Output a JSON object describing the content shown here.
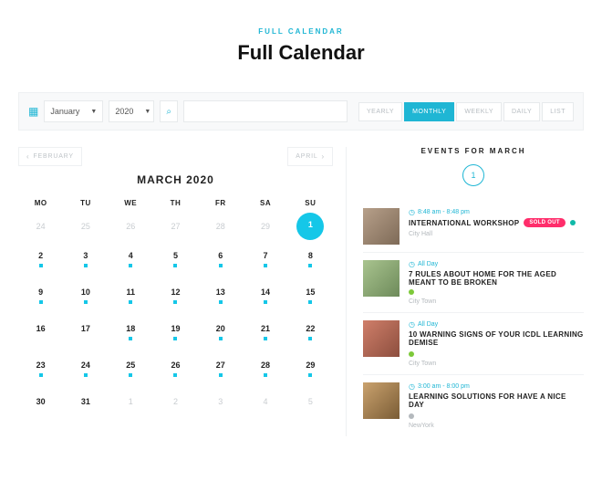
{
  "header": {
    "eyebrow": "FULL CALENDAR",
    "title": "Full Calendar"
  },
  "toolbar": {
    "month_select": "January",
    "year_select": "2020",
    "views": {
      "yearly": "YEARLY",
      "monthly": "MONTHLY",
      "weekly": "WEEKLY",
      "daily": "DAILY",
      "list": "LIST"
    }
  },
  "calendar": {
    "prev_label": "FEBRUARY",
    "next_label": "APRIL",
    "month_title": "MARCH 2020",
    "dow": [
      "MO",
      "TU",
      "WE",
      "TH",
      "FR",
      "SA",
      "SU"
    ],
    "selected_day": "1",
    "weeks": [
      [
        {
          "n": "24",
          "muted": true
        },
        {
          "n": "25",
          "muted": true
        },
        {
          "n": "26",
          "muted": true
        },
        {
          "n": "27",
          "muted": true
        },
        {
          "n": "28",
          "muted": true
        },
        {
          "n": "29",
          "muted": true
        },
        {
          "n": "1",
          "selected": true,
          "dot": false
        }
      ],
      [
        {
          "n": "2",
          "dot": true
        },
        {
          "n": "3",
          "dot": true
        },
        {
          "n": "4",
          "dot": true
        },
        {
          "n": "5",
          "dot": true
        },
        {
          "n": "6",
          "dot": true
        },
        {
          "n": "7",
          "dot": true
        },
        {
          "n": "8",
          "dot": true
        }
      ],
      [
        {
          "n": "9",
          "dot": true
        },
        {
          "n": "10",
          "dot": true
        },
        {
          "n": "11",
          "dot": true
        },
        {
          "n": "12",
          "dot": true
        },
        {
          "n": "13",
          "dot": true
        },
        {
          "n": "14",
          "dot": true
        },
        {
          "n": "15",
          "dot": true
        }
      ],
      [
        {
          "n": "16"
        },
        {
          "n": "17"
        },
        {
          "n": "18",
          "dot": true
        },
        {
          "n": "19",
          "dot": true
        },
        {
          "n": "20",
          "dot": true
        },
        {
          "n": "21",
          "dot": true
        },
        {
          "n": "22",
          "dot": true
        }
      ],
      [
        {
          "n": "23",
          "dot": true
        },
        {
          "n": "24",
          "dot": true
        },
        {
          "n": "25",
          "dot": true
        },
        {
          "n": "26",
          "dot": true
        },
        {
          "n": "27",
          "dot": true
        },
        {
          "n": "28",
          "dot": true
        },
        {
          "n": "29",
          "dot": true
        }
      ],
      [
        {
          "n": "30"
        },
        {
          "n": "31"
        },
        {
          "n": "1",
          "muted": true
        },
        {
          "n": "2",
          "muted": true
        },
        {
          "n": "3",
          "muted": true
        },
        {
          "n": "4",
          "muted": true
        },
        {
          "n": "5",
          "muted": true
        }
      ]
    ]
  },
  "events_panel": {
    "heading": "EVENTS FOR MARCH",
    "day": "1",
    "items": [
      {
        "time": "8:48 am - 8:48 pm",
        "title": "INTERNATIONAL WORKSHOP",
        "badge": "SOLD OUT",
        "status": "teal",
        "location": "City Hall",
        "thumb": "t1"
      },
      {
        "time": "All Day",
        "title": "7 RULES ABOUT HOME FOR THE AGED MEANT TO BE BROKEN",
        "status": "green",
        "status_inline": true,
        "location": "City Town",
        "thumb": "t2"
      },
      {
        "time": "All Day",
        "title": "10 WARNING SIGNS OF YOUR ICDL LEARNING DEMISE",
        "status": "green",
        "location": "City Town",
        "thumb": "t3"
      },
      {
        "time": "3:00 am - 8:00 pm",
        "title": "LEARNING SOLUTIONS FOR HAVE A NICE DAY",
        "status": "grey",
        "location": "NewYork",
        "thumb": "t4"
      }
    ]
  }
}
